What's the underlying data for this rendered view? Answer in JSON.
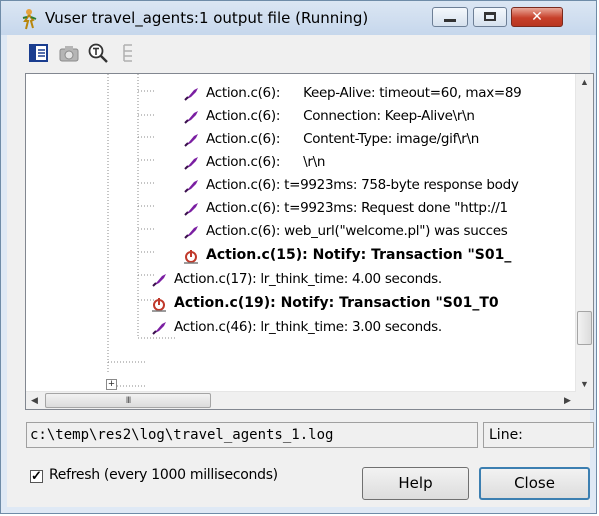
{
  "window": {
    "title": "Vuser travel_agents:1 output file (Running)",
    "title_buttons": {
      "close_glyph": "✕"
    }
  },
  "toolbar": {
    "tools": [
      {
        "icon": "display-mode-icon"
      },
      {
        "icon": "camera-icon"
      },
      {
        "icon": "find-icon"
      },
      {
        "icon": "tree-view-icon"
      }
    ]
  },
  "log_rows": [
    {
      "icon": "step-icon",
      "prefix": "Action.c(6):",
      "text": "Keep-Alive: timeout=60, max=89",
      "tabbed": true,
      "bold": false
    },
    {
      "icon": "step-icon",
      "prefix": "Action.c(6):",
      "text": "Connection: Keep-Alive\\r\\n",
      "tabbed": true,
      "bold": false
    },
    {
      "icon": "step-icon",
      "prefix": "Action.c(6):",
      "text": "Content-Type: image/gif\\r\\n",
      "tabbed": true,
      "bold": false
    },
    {
      "icon": "step-icon",
      "prefix": "Action.c(6):",
      "text": "\\r\\n",
      "tabbed": true,
      "bold": false
    },
    {
      "icon": "step-icon",
      "prefix": "Action.c(6):",
      "text": "t=9923ms: 758-byte response body",
      "tabbed": false,
      "bold": false
    },
    {
      "icon": "step-icon",
      "prefix": "Action.c(6):",
      "text": "t=9923ms: Request done \"http://1",
      "tabbed": false,
      "bold": false
    },
    {
      "icon": "step-icon",
      "prefix": "Action.c(6):",
      "text": "web_url(\"welcome.pl\") was succes",
      "tabbed": false,
      "bold": false
    },
    {
      "icon": "transaction-icon",
      "prefix": "Action.c(15):",
      "text": "Notify: Transaction \"S01_",
      "tabbed": false,
      "bold": true
    },
    {
      "icon": "step-icon",
      "prefix": "Action.c(17):",
      "text": "lr_think_time: 4.00 seconds.",
      "tabbed": false,
      "bold": false
    },
    {
      "icon": "transaction-icon",
      "prefix": "Action.c(19):",
      "text": "Notify: Transaction \"S01_T0",
      "tabbed": false,
      "bold": true
    },
    {
      "icon": "step-icon",
      "prefix": "Action.c(46):",
      "text": "lr_think_time: 3.00 seconds.",
      "tabbed": false,
      "bold": false
    }
  ],
  "scrollbar": {
    "up_arrow": "▲",
    "down_arrow": "▼",
    "left_arrow": "◀",
    "right_arrow": "▶",
    "thumb_grip": "III"
  },
  "expander": "+",
  "status": {
    "log_path": "c:\\temp\\res2\\log\\travel_agents_1.log",
    "line_label": "Line:"
  },
  "refresh": {
    "checked": true,
    "check_mark": "✓",
    "label": "Refresh (every 1000 milliseconds)"
  },
  "buttons": {
    "help": "Help",
    "close": "Close"
  },
  "colors": {
    "step_icon": "#7b1fa2",
    "transaction_icon": "#c0392b",
    "tree_line": "#8a8a8a"
  }
}
